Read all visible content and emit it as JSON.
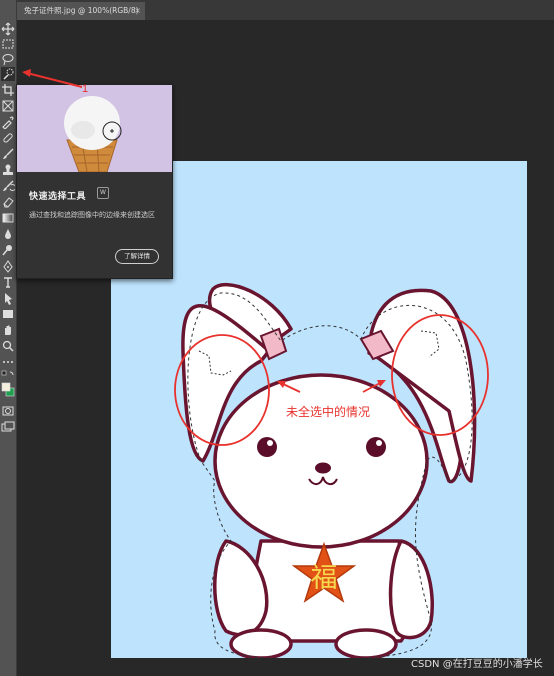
{
  "tabs": [
    {
      "label": "兔子证件照.jpg @ 100%(RGB/8)",
      "close": "×"
    }
  ],
  "tools": [
    "move-icon",
    "marquee-icon",
    "lasso-icon",
    "quick-selection-icon",
    "crop-icon",
    "frame-icon",
    "eyedropper-icon",
    "healing-brush-icon",
    "brush-icon",
    "clone-stamp-icon",
    "history-brush-icon",
    "eraser-icon",
    "gradient-icon",
    "blur-icon",
    "dodge-icon",
    "pen-icon",
    "type-icon",
    "path-selection-icon",
    "rectangle-icon",
    "hand-icon",
    "zoom-icon",
    "more-tools-icon"
  ],
  "tooltip": {
    "title": "快速选择工具",
    "shortcut": "W",
    "description": "通过查找和追踪图像中的边缘来创建选区",
    "button": "了解详情"
  },
  "annotations": {
    "step_number": "1",
    "note": "未全选中的情况"
  },
  "artwork": {
    "star_char": "福"
  },
  "colors": {
    "document_background": "#bde3fd",
    "annotation_red": "#e8322d",
    "outline": "#6a1530",
    "star": "#e25216",
    "star_char": "#f5d84e"
  },
  "watermark": "CSDN @在打豆豆的小潘学长"
}
